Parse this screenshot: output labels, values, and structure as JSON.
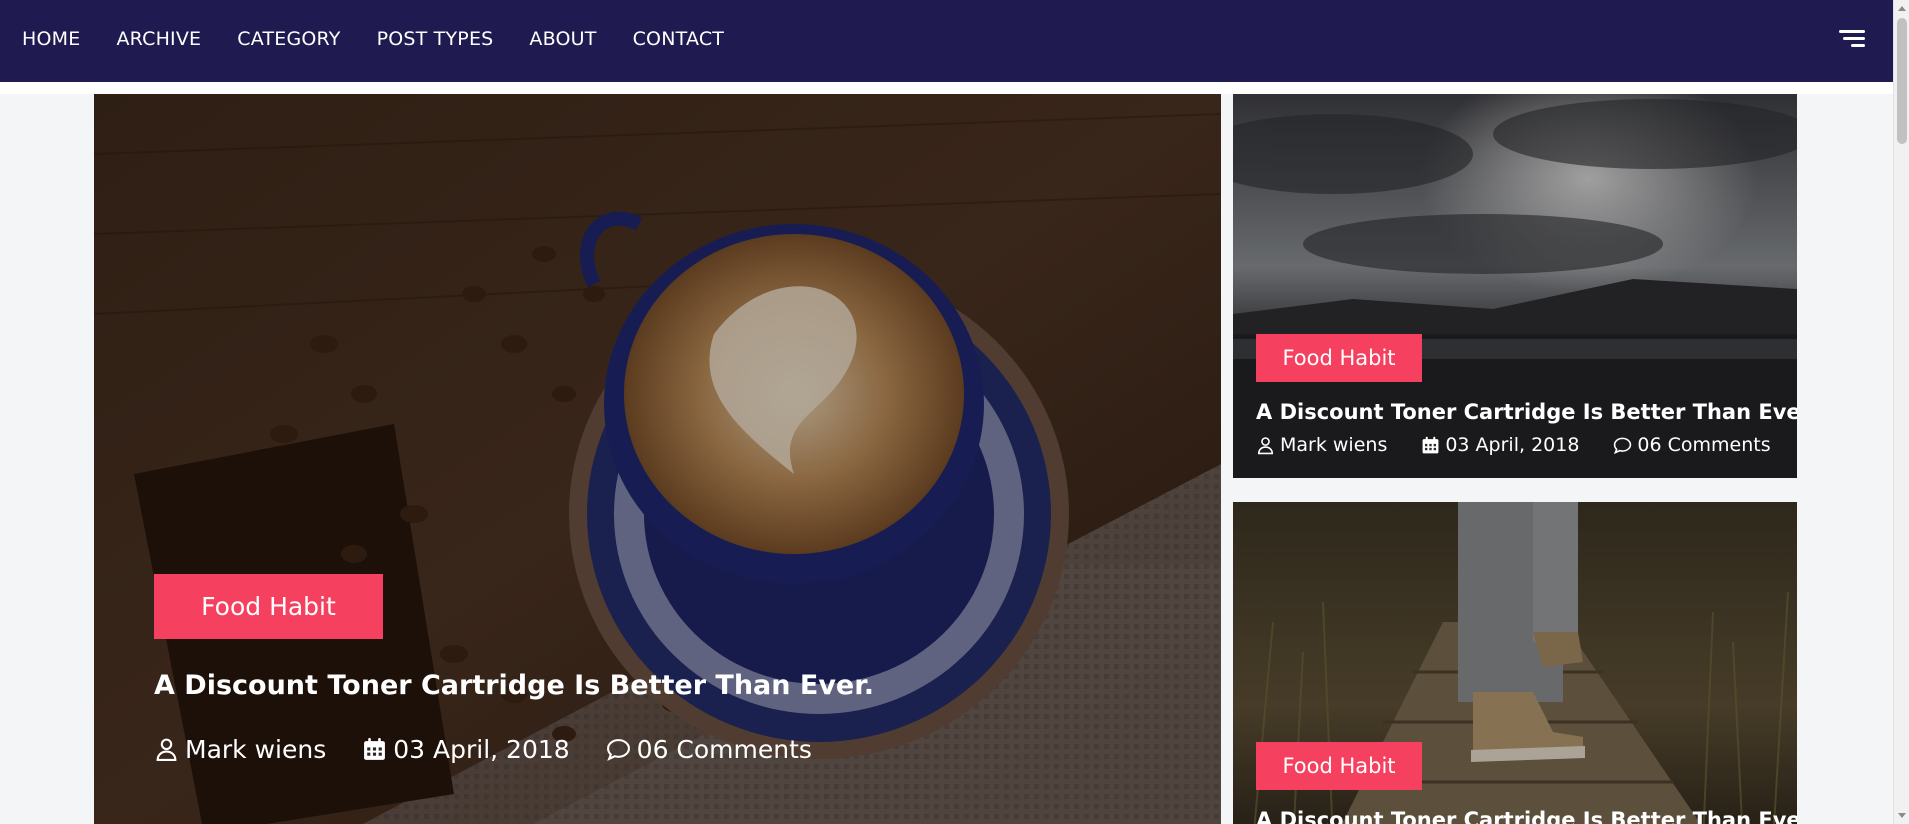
{
  "nav": {
    "items": [
      "HOME",
      "ARCHIVE",
      "CATEGORY",
      "POST TYPES",
      "ABOUT",
      "CONTACT"
    ],
    "menu_icon": "hamburger-menu-icon",
    "background": "#1f1b50"
  },
  "accent_color": "#f5405f",
  "posts": {
    "featured": {
      "category": "Food Habit",
      "title": "A Discount Toner Cartridge Is Better Than Ever.",
      "author": "Mark wiens",
      "date": "03 April, 2018",
      "comments": "06 Comments",
      "image": "coffee-latte-art-photo"
    },
    "side_top": {
      "category": "Food Habit",
      "title": "A Discount Toner Cartridge Is Better Than Ever.",
      "author": "Mark wiens",
      "date": "03 April, 2018",
      "comments": "06 Comments",
      "image": "cloudy-sky-landscape-photo"
    },
    "side_bottom": {
      "category": "Food Habit",
      "title": "A Discount Toner Cartridge Is Better Than Ever.",
      "image": "walking-sneakers-boardwalk-photo"
    }
  }
}
